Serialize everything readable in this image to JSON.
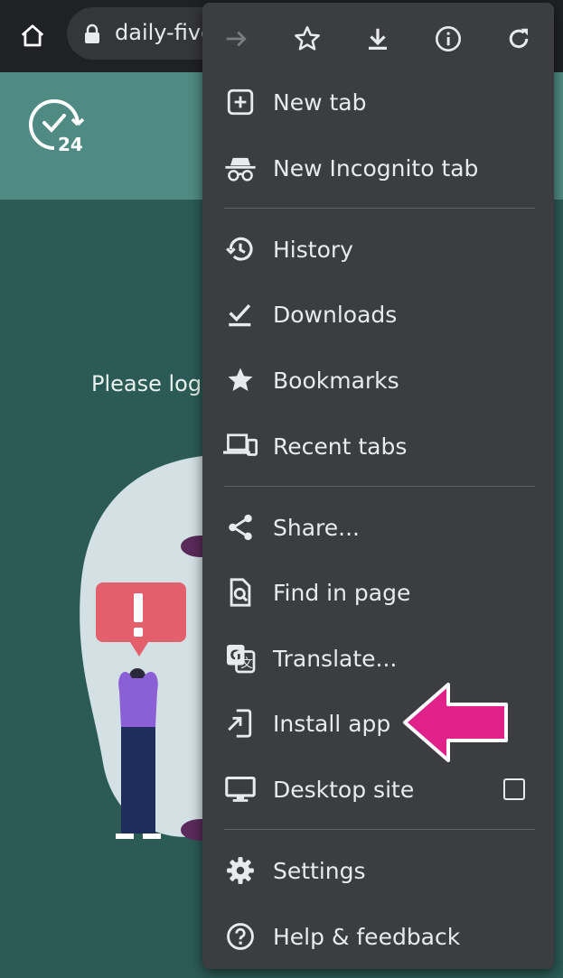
{
  "browser": {
    "url": "daily-five",
    "toolbar": [
      "forward-icon",
      "star-icon",
      "download-icon",
      "info-icon",
      "reload-icon"
    ]
  },
  "page": {
    "login_text": "Please log"
  },
  "menu": {
    "items": [
      {
        "label": "New tab",
        "icon": "new-tab-icon"
      },
      {
        "label": "New Incognito tab",
        "icon": "incognito-icon"
      },
      {
        "label": "History",
        "icon": "history-icon"
      },
      {
        "label": "Downloads",
        "icon": "downloads-icon"
      },
      {
        "label": "Bookmarks",
        "icon": "bookmarks-icon"
      },
      {
        "label": "Recent tabs",
        "icon": "recent-tabs-icon"
      },
      {
        "label": "Share...",
        "icon": "share-icon"
      },
      {
        "label": "Find in page",
        "icon": "find-in-page-icon"
      },
      {
        "label": "Translate...",
        "icon": "translate-icon"
      },
      {
        "label": "Install app",
        "icon": "install-app-icon"
      },
      {
        "label": "Desktop site",
        "icon": "desktop-icon"
      },
      {
        "label": "Settings",
        "icon": "settings-icon"
      },
      {
        "label": "Help & feedback",
        "icon": "help-icon"
      }
    ]
  },
  "colors": {
    "menu_bg": "#3c3d40",
    "topbar_bg": "#202124",
    "page_header": "#4f8b82",
    "page_bg": "#2c5b56",
    "annotation_arrow": "#e0218a"
  }
}
